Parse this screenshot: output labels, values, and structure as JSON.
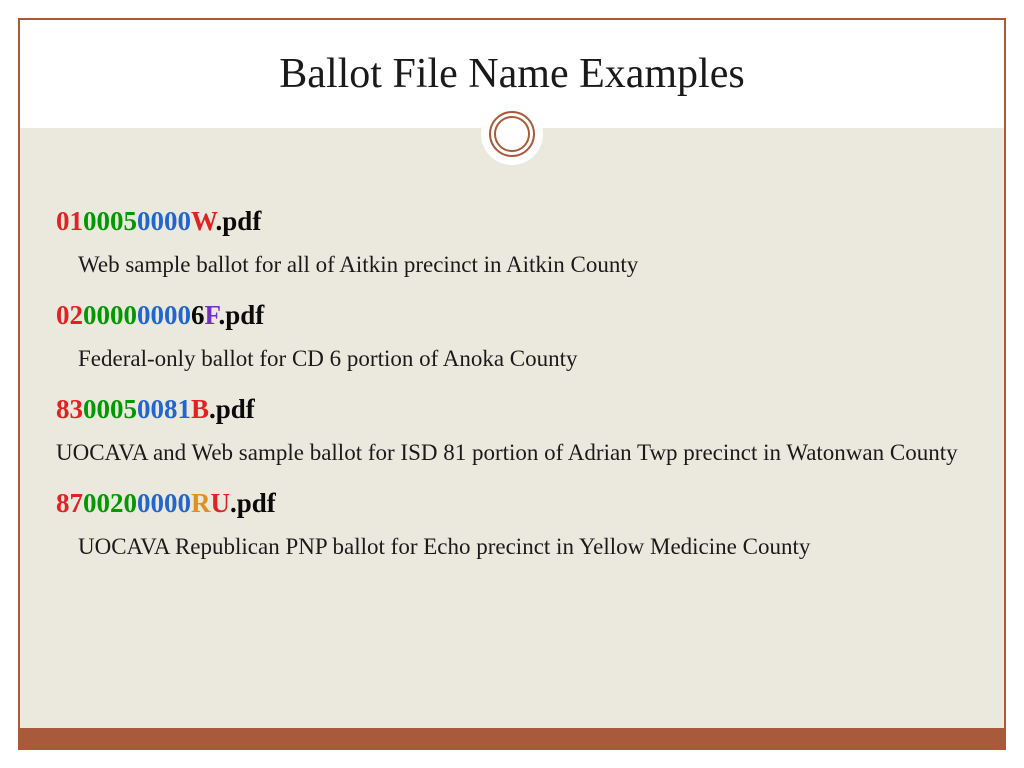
{
  "title": "Ballot File Name Examples",
  "examples": [
    {
      "segments": [
        {
          "text": "01",
          "cls": "seg-red"
        },
        {
          "text": "0005",
          "cls": "seg-green"
        },
        {
          "text": "0000",
          "cls": "seg-blue"
        },
        {
          "text": "W",
          "cls": "seg-red"
        },
        {
          "text": ".pdf",
          "cls": "seg-black"
        }
      ],
      "description": "Web sample ballot for all of Aitkin precinct in Aitkin County"
    },
    {
      "segments": [
        {
          "text": "02",
          "cls": "seg-red"
        },
        {
          "text": "0000",
          "cls": "seg-green"
        },
        {
          "text": "0000",
          "cls": "seg-blue"
        },
        {
          "text": "6",
          "cls": "seg-black"
        },
        {
          "text": "F",
          "cls": "seg-purple"
        },
        {
          "text": ".pdf",
          "cls": "seg-black"
        }
      ],
      "description": "Federal-only ballot for CD 6 portion of Anoka County"
    },
    {
      "segments": [
        {
          "text": "83",
          "cls": "seg-red"
        },
        {
          "text": "0005",
          "cls": "seg-green"
        },
        {
          "text": "0081",
          "cls": "seg-blue"
        },
        {
          "text": "B",
          "cls": "seg-red"
        },
        {
          "text": ".pdf",
          "cls": "seg-black"
        }
      ],
      "description": "UOCAVA and Web sample ballot for ISD 81 portion of Adrian Twp precinct in Watonwan County",
      "nopad": true
    },
    {
      "segments": [
        {
          "text": "87",
          "cls": "seg-red"
        },
        {
          "text": "0020",
          "cls": "seg-green"
        },
        {
          "text": "0000",
          "cls": "seg-blue"
        },
        {
          "text": "R",
          "cls": "seg-orange"
        },
        {
          "text": "U",
          "cls": "seg-red"
        },
        {
          "text": ".pdf",
          "cls": "seg-black"
        }
      ],
      "description": "UOCAVA Republican PNP ballot for Echo precinct in Yellow Medicine County"
    }
  ]
}
